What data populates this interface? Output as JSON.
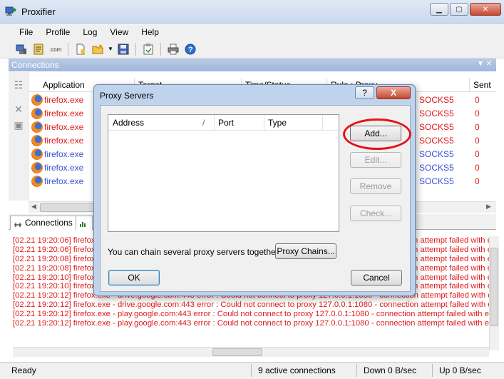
{
  "window": {
    "title": "Proxifier"
  },
  "menu": [
    "File",
    "Profile",
    "Log",
    "View",
    "Help"
  ],
  "toolbar_icons": [
    "proxy-servers-icon",
    "rules-icon",
    "dns-icon",
    "new-profile-icon",
    "open-profile-icon",
    "save-profile-icon",
    "export-icon",
    "print-icon",
    "help-icon"
  ],
  "connections": {
    "panel_title": "Connections",
    "columns": [
      "Application",
      "Target",
      "Time/Status",
      "Rule : Proxy",
      "Sent"
    ],
    "rows": [
      {
        "app": "firefox.exe",
        "rule": "SOCKS5",
        "sent": "0",
        "color": "#e01b1b"
      },
      {
        "app": "firefox.exe",
        "rule": "SOCKS5",
        "sent": "0",
        "color": "#e01b1b"
      },
      {
        "app": "firefox.exe",
        "rule": "SOCKS5",
        "sent": "0",
        "color": "#e01b1b"
      },
      {
        "app": "firefox.exe",
        "rule": "SOCKS5",
        "sent": "0",
        "color": "#e01b1b"
      },
      {
        "app": "firefox.exe",
        "rule": "SOCKS5",
        "sent": "0",
        "color": "#3a4fd8"
      },
      {
        "app": "firefox.exe",
        "rule": "SOCKS5",
        "sent": "0",
        "color": "#3a4fd8"
      },
      {
        "app": "firefox.exe",
        "rule": "SOCKS5",
        "sent": "0",
        "color": "#3a4fd8"
      }
    ]
  },
  "tabs": {
    "connections": "Connections"
  },
  "log_lines": [
    "[02.21 19:20:06] firefox.exe - www.google.com:443 error : Could not connect to proxy 127.0.0.1:1080 - connection attempt failed with error 10061",
    "[02.21 19:20:06] firefox.exe - www.google.com:443 error : Could not connect to proxy 127.0.0.1:1080 - connection attempt failed with error 10061",
    "[02.21 19:20:08] firefox.exe - www.google.com:443 error : Could not connect to proxy 127.0.0.1:1080 - connection attempt failed with error 10061",
    "[02.21 19:20:08] firefox.exe - www.google.com:443 error : Could not connect to proxy 127.0.0.1:1080 - connection attempt failed with error 10061",
    "[02.21 19:20:10] firefox.exe - www.google.com:443 error : Could not connect to proxy 127.0.0.1:1080 - connection attempt failed with error 10061",
    "[02.21 19:20:10] firefox.exe - www.google.com:443 error : Could not connect to proxy 127.0.0.1:1080 - connection attempt failed with error 10061",
    "[02.21 19:20:12] firefox.exe - drive.google.com:443 error : Could not connect to proxy 127.0.0.1:1080 - connection attempt failed with error 10061",
    "[02.21 19:20:12] firefox.exe - drive.google.com:443 error : Could not connect to proxy 127.0.0.1:1080 - connection attempt failed with error 10061",
    "[02.21 19:20:12] firefox.exe - play.google.com:443 error : Could not connect to proxy 127.0.0.1:1080 - connection attempt failed with error 10061",
    "[02.21 19:20:12] firefox.exe - play.google.com:443 error : Could not connect to proxy 127.0.0.1:1080 - connection attempt failed with error 10061"
  ],
  "status": {
    "left": "Ready",
    "active": "9 active connections",
    "down": "Down 0 B/sec",
    "up": "Up 0 B/sec"
  },
  "dialog": {
    "title": "Proxy Servers",
    "help": "?",
    "close": "X",
    "list_columns": [
      "Address",
      "Port",
      "Type"
    ],
    "sort_indicator": "/",
    "buttons": {
      "add": "Add...",
      "edit": "Edit...",
      "remove": "Remove",
      "check": "Check..."
    },
    "chain_text": "You can chain several proxy servers together:",
    "chain_button": "Proxy Chains...",
    "ok": "OK",
    "cancel": "Cancel"
  }
}
